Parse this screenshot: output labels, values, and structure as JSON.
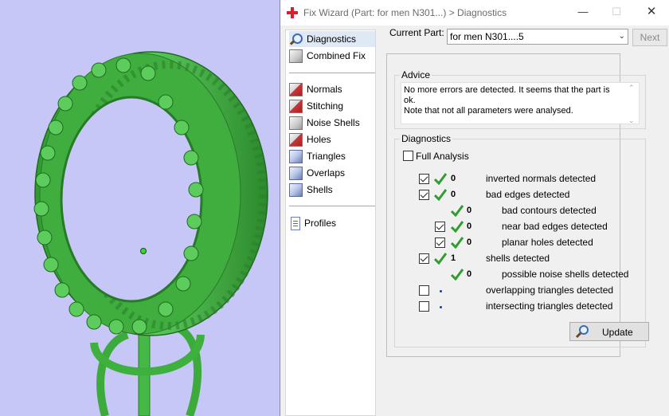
{
  "window": {
    "title": "Fix Wizard (Part: for men N301...) > Diagnostics",
    "minimize_glyph": "—",
    "maximize_glyph": "☐",
    "close_glyph": "✕"
  },
  "nav": {
    "items": [
      {
        "label": "Diagnostics",
        "icon": "magnifier-icon",
        "selected": true
      },
      {
        "label": "Combined Fix",
        "icon": "cube-icon"
      },
      {
        "label": "Normals",
        "icon": "normals-icon"
      },
      {
        "label": "Stitching",
        "icon": "stitching-icon"
      },
      {
        "label": "Noise Shells",
        "icon": "noise-shells-icon"
      },
      {
        "label": "Holes",
        "icon": "holes-icon"
      },
      {
        "label": "Triangles",
        "icon": "triangles-icon"
      },
      {
        "label": "Overlaps",
        "icon": "overlaps-icon"
      },
      {
        "label": "Shells",
        "icon": "shells-icon"
      },
      {
        "label": "Profiles",
        "icon": "profiles-icon"
      }
    ]
  },
  "header": {
    "current_part_label": "Current Part:",
    "current_part_value": "for men N301....5",
    "next_label": "Next"
  },
  "advice": {
    "title": "Advice",
    "line1": "No more errors are detected. It seems that the part is ok.",
    "line2": "Note that not all parameters were analysed."
  },
  "diagnostics": {
    "title": "Diagnostics",
    "full_analysis_label": "Full Analysis",
    "full_analysis_checked": false,
    "rows": [
      {
        "checked": true,
        "status": "ok",
        "count": "0",
        "label": "inverted normals detected",
        "indent": 0
      },
      {
        "checked": true,
        "status": "ok",
        "count": "0",
        "label": "bad edges detected",
        "indent": 0
      },
      {
        "checked": null,
        "status": "ok",
        "count": "0",
        "label": "bad contours detected",
        "indent": 1
      },
      {
        "checked": true,
        "status": "ok",
        "count": "0",
        "label": "near bad edges detected",
        "indent": 1
      },
      {
        "checked": true,
        "status": "ok",
        "count": "0",
        "label": "planar holes detected",
        "indent": 1
      },
      {
        "checked": true,
        "status": "ok",
        "count": "1",
        "label": "shells detected",
        "indent": 0
      },
      {
        "checked": null,
        "status": "ok",
        "count": "0",
        "label": "possible noise shells detected",
        "indent": 1
      },
      {
        "checked": false,
        "status": "pending",
        "count": "",
        "label": "overlapping triangles detected",
        "indent": 0
      },
      {
        "checked": false,
        "status": "pending",
        "count": "",
        "label": "intersecting triangles detected",
        "indent": 0
      }
    ],
    "update_label": "Update"
  },
  "colors": {
    "viewport_bg": "#c6c6f7",
    "model_green": "#46b846",
    "check_green": "#2e9e2e",
    "accent_red": "#d8202a"
  }
}
